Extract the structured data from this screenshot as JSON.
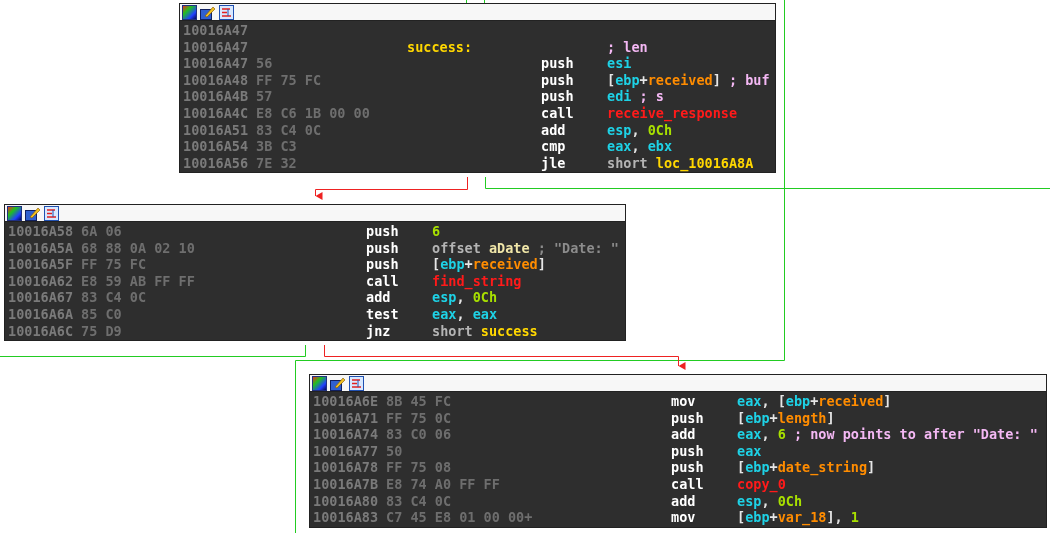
{
  "nodes": [
    {
      "rows": [
        {
          "address": "10016A47"
        },
        {
          "address": "10016A47",
          "label": "success:",
          "operand": [
            {
              "kind": "comment",
              "text": "; len"
            }
          ]
        },
        {
          "address": "10016A47",
          "bytes": "56",
          "mnemonic": "push",
          "operand": [
            {
              "kind": "reg",
              "text": "esi"
            }
          ]
        },
        {
          "address": "10016A48",
          "bytes": "FF 75 FC",
          "mnemonic": "push",
          "operand": [
            {
              "kind": "punct",
              "text": "["
            },
            {
              "kind": "reg",
              "text": "ebp"
            },
            {
              "kind": "punct",
              "text": "+"
            },
            {
              "kind": "var",
              "text": "received"
            },
            {
              "kind": "punct",
              "text": "]"
            },
            {
              "kind": "comment",
              "text": " ; buf"
            }
          ]
        },
        {
          "address": "10016A4B",
          "bytes": "57",
          "mnemonic": "push",
          "operand": [
            {
              "kind": "reg",
              "text": "edi"
            },
            {
              "kind": "comment",
              "text": " ; s"
            }
          ]
        },
        {
          "address": "10016A4C",
          "bytes": "E8 C6 1B 00 00",
          "mnemonic": "call",
          "operand": [
            {
              "kind": "func",
              "text": "receive_response"
            }
          ]
        },
        {
          "address": "10016A51",
          "bytes": "83 C4 0C",
          "mnemonic": "add",
          "operand": [
            {
              "kind": "reg",
              "text": "esp"
            },
            {
              "kind": "punct",
              "text": ", "
            },
            {
              "kind": "num",
              "text": "0Ch"
            }
          ]
        },
        {
          "address": "10016A54",
          "bytes": "3B C3",
          "mnemonic": "cmp",
          "operand": [
            {
              "kind": "reg",
              "text": "eax"
            },
            {
              "kind": "punct",
              "text": ", "
            },
            {
              "kind": "reg",
              "text": "ebx"
            }
          ]
        },
        {
          "address": "10016A56",
          "bytes": "7E 32",
          "mnemonic": "jle",
          "operand": [
            {
              "kind": "keyword",
              "text": "short "
            },
            {
              "kind": "label",
              "text": "loc_10016A8A"
            }
          ]
        }
      ]
    },
    {
      "rows": [
        {
          "address": "10016A58",
          "bytes": "6A 06",
          "mnemonic": "push",
          "operand": [
            {
              "kind": "num",
              "text": "6"
            }
          ]
        },
        {
          "address": "10016A5A",
          "bytes": "68 88 0A 02 10",
          "mnemonic": "push",
          "operand": [
            {
              "kind": "keyword",
              "text": "offset "
            },
            {
              "kind": "data",
              "text": "aDate"
            },
            {
              "kind": "string",
              "text": " ; \"Date: \""
            }
          ]
        },
        {
          "address": "10016A5F",
          "bytes": "FF 75 FC",
          "mnemonic": "push",
          "operand": [
            {
              "kind": "punct",
              "text": "["
            },
            {
              "kind": "reg",
              "text": "ebp"
            },
            {
              "kind": "punct",
              "text": "+"
            },
            {
              "kind": "var",
              "text": "received"
            },
            {
              "kind": "punct",
              "text": "]"
            }
          ]
        },
        {
          "address": "10016A62",
          "bytes": "E8 59 AB FF FF",
          "mnemonic": "call",
          "operand": [
            {
              "kind": "func",
              "text": "find_string"
            }
          ]
        },
        {
          "address": "10016A67",
          "bytes": "83 C4 0C",
          "mnemonic": "add",
          "operand": [
            {
              "kind": "reg",
              "text": "esp"
            },
            {
              "kind": "punct",
              "text": ", "
            },
            {
              "kind": "num",
              "text": "0Ch"
            }
          ]
        },
        {
          "address": "10016A6A",
          "bytes": "85 C0",
          "mnemonic": "test",
          "operand": [
            {
              "kind": "reg",
              "text": "eax"
            },
            {
              "kind": "punct",
              "text": ", "
            },
            {
              "kind": "reg",
              "text": "eax"
            }
          ]
        },
        {
          "address": "10016A6C",
          "bytes": "75 D9",
          "mnemonic": "jnz",
          "operand": [
            {
              "kind": "keyword",
              "text": "short "
            },
            {
              "kind": "label",
              "text": "success"
            }
          ]
        }
      ]
    },
    {
      "rows": [
        {
          "address": "10016A6E",
          "bytes": "8B 45 FC",
          "mnemonic": "mov",
          "operand": [
            {
              "kind": "reg",
              "text": "eax"
            },
            {
              "kind": "punct",
              "text": ", ["
            },
            {
              "kind": "reg",
              "text": "ebp"
            },
            {
              "kind": "punct",
              "text": "+"
            },
            {
              "kind": "var",
              "text": "received"
            },
            {
              "kind": "punct",
              "text": "]"
            }
          ]
        },
        {
          "address": "10016A71",
          "bytes": "FF 75 0C",
          "mnemonic": "push",
          "operand": [
            {
              "kind": "punct",
              "text": "["
            },
            {
              "kind": "reg",
              "text": "ebp"
            },
            {
              "kind": "punct",
              "text": "+"
            },
            {
              "kind": "var",
              "text": "length"
            },
            {
              "kind": "punct",
              "text": "]"
            }
          ]
        },
        {
          "address": "10016A74",
          "bytes": "83 C0 06",
          "mnemonic": "add",
          "operand": [
            {
              "kind": "reg",
              "text": "eax"
            },
            {
              "kind": "punct",
              "text": ", "
            },
            {
              "kind": "num",
              "text": "6"
            },
            {
              "kind": "comment",
              "text": " ; now points to after \"Date: \""
            }
          ]
        },
        {
          "address": "10016A77",
          "bytes": "50",
          "mnemonic": "push",
          "operand": [
            {
              "kind": "reg",
              "text": "eax"
            }
          ]
        },
        {
          "address": "10016A78",
          "bytes": "FF 75 08",
          "mnemonic": "push",
          "operand": [
            {
              "kind": "punct",
              "text": "["
            },
            {
              "kind": "reg",
              "text": "ebp"
            },
            {
              "kind": "punct",
              "text": "+"
            },
            {
              "kind": "var",
              "text": "date_string"
            },
            {
              "kind": "punct",
              "text": "]"
            }
          ]
        },
        {
          "address": "10016A7B",
          "bytes": "E8 74 A0 FF FF",
          "mnemonic": "call",
          "operand": [
            {
              "kind": "func",
              "text": "copy_0"
            }
          ]
        },
        {
          "address": "10016A80",
          "bytes": "83 C4 0C",
          "mnemonic": "add",
          "operand": [
            {
              "kind": "reg",
              "text": "esp"
            },
            {
              "kind": "punct",
              "text": ", "
            },
            {
              "kind": "num",
              "text": "0Ch"
            }
          ]
        },
        {
          "address": "10016A83",
          "bytes": "C7 45 E8 01 00 00+",
          "mnemonic": "mov",
          "operand": [
            {
              "kind": "punct",
              "text": "["
            },
            {
              "kind": "reg",
              "text": "ebp"
            },
            {
              "kind": "punct",
              "text": "+"
            },
            {
              "kind": "var",
              "text": "var_18"
            },
            {
              "kind": "punct",
              "text": "], "
            },
            {
              "kind": "num",
              "text": "1"
            }
          ]
        }
      ]
    }
  ]
}
